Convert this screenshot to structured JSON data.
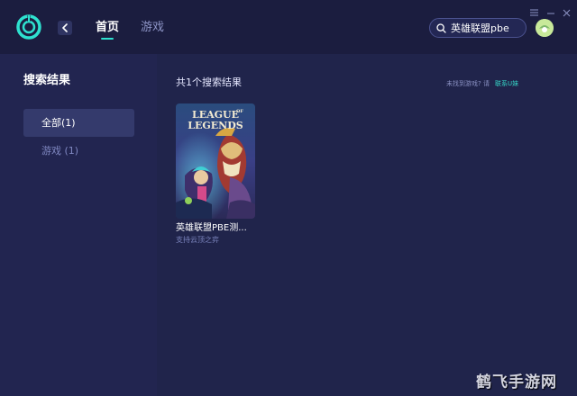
{
  "header": {
    "logo_icon": "app-logo-ring-icon",
    "back_icon": "chevron-left-icon",
    "nav": [
      {
        "label": "首页",
        "active": true
      },
      {
        "label": "游戏",
        "active": false
      }
    ],
    "search": {
      "value": "英雄联盟pbe",
      "icon": "search-icon"
    },
    "window_controls": [
      "menu-icon",
      "minimize-icon",
      "close-icon"
    ],
    "accent": "#2ee1cf"
  },
  "sidebar": {
    "title": "搜索结果",
    "filters": [
      {
        "label": "全部(1)",
        "selected": true
      },
      {
        "label": "游戏 (1)",
        "selected": false
      }
    ]
  },
  "main": {
    "result_count": "共1个搜索结果",
    "not_found_text": "未找到游戏? 请",
    "contact_link": "联系U妹",
    "results": [
      {
        "cover_logo_line1": "LEAGUE",
        "cover_logo_of": "OF",
        "cover_logo_line2": "LEGENDS",
        "name": "英雄联盟PBE测...",
        "subtitle": "支持云顶之弈"
      }
    ]
  },
  "watermark": "鹤飞手游网"
}
